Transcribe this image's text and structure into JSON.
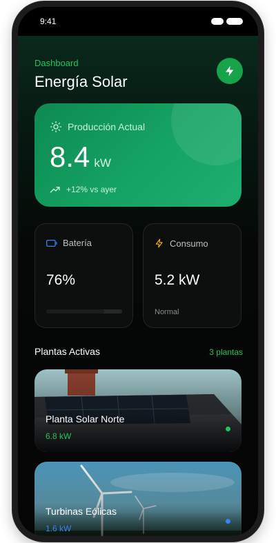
{
  "status": {
    "time": "9:41"
  },
  "header": {
    "subtitle": "Dashboard",
    "title": "Energía Solar"
  },
  "production": {
    "label": "Producción Actual",
    "value": "8.4",
    "unit": "kW",
    "trend": "+12% vs ayer"
  },
  "battery": {
    "label": "Batería",
    "value": "76%",
    "level": 0.76
  },
  "consumption": {
    "label": "Consumo",
    "value": "5.2 kW",
    "note": "Normal"
  },
  "plants": {
    "title": "Plantas Activas",
    "count": "3 plantas",
    "items": [
      {
        "name": "Planta Solar Norte",
        "power": "6.8 kW",
        "color": "#22c55e"
      },
      {
        "name": "Turbinas Eólicas",
        "power": "1.6 kW",
        "color": "#3b82f6"
      }
    ]
  },
  "colors": {
    "accent": "#22c55e",
    "card_green": "#15a363",
    "battery_icon": "#3b82f6",
    "bolt_icon": "#f5b40a"
  }
}
